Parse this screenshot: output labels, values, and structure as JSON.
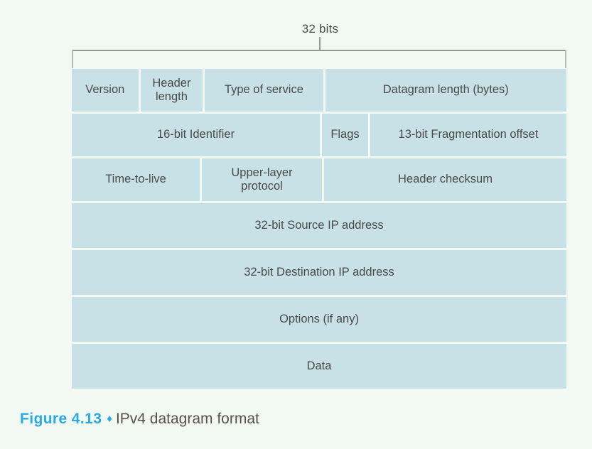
{
  "figure": {
    "width_label": "32 bits",
    "caption_number": "Figure 4.13",
    "caption_separator": "♦",
    "caption_text": "IPv4 datagram format"
  },
  "colors": {
    "background": "#f2f8f2",
    "cell_fill": "#c7e1e6",
    "cell_text": "#4a4a4a",
    "bracket": "#8f9a91",
    "accent": "#29abe2",
    "caption_text": "#5a5248"
  },
  "chart_data": {
    "type": "table",
    "title": "IPv4 datagram format",
    "total_bits_per_row": 32,
    "rows": [
      {
        "fields": [
          {
            "label": "Version",
            "bits": 4
          },
          {
            "label": "Header\nlength",
            "bits": 4
          },
          {
            "label": "Type of service",
            "bits": 8
          },
          {
            "label": "Datagram length (bytes)",
            "bits": 16
          }
        ]
      },
      {
        "fields": [
          {
            "label": "16-bit Identifier",
            "bits": 16
          },
          {
            "label": "Flags",
            "bits": 3
          },
          {
            "label": "13-bit Fragmentation offset",
            "bits": 13
          }
        ]
      },
      {
        "fields": [
          {
            "label": "Time-to-live",
            "bits": 8
          },
          {
            "label": "Upper-layer\nprotocol",
            "bits": 8
          },
          {
            "label": "Header checksum",
            "bits": 16
          }
        ]
      },
      {
        "fields": [
          {
            "label": "32-bit Source IP address",
            "bits": 32
          }
        ]
      },
      {
        "fields": [
          {
            "label": "32-bit Destination IP address",
            "bits": 32
          }
        ]
      },
      {
        "fields": [
          {
            "label": "Options (if any)",
            "bits": 32
          }
        ]
      },
      {
        "fields": [
          {
            "label": "Data",
            "bits": 32
          }
        ]
      }
    ]
  }
}
